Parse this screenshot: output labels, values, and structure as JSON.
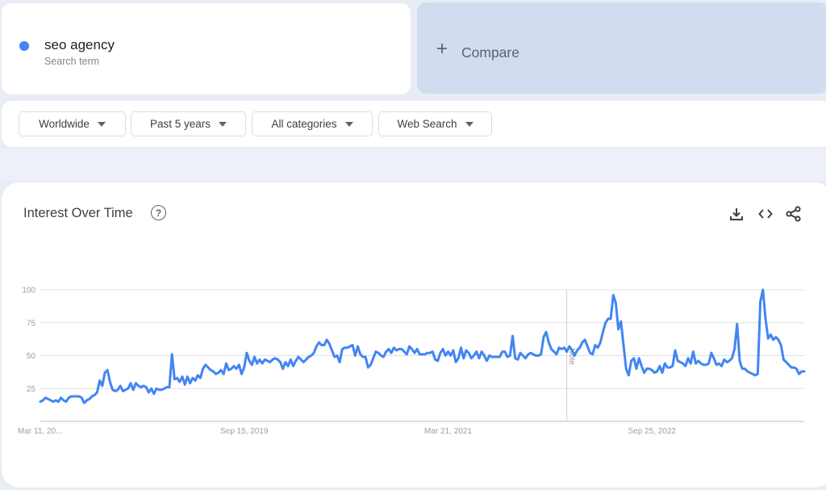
{
  "search_term": {
    "name": "seo agency",
    "subtitle": "Search term",
    "color": "#4285f4"
  },
  "compare": {
    "icon": "plus-icon",
    "label": "Compare"
  },
  "filters": [
    {
      "label": "Worldwide",
      "icon": "caret-down-icon"
    },
    {
      "label": "Past 5 years",
      "icon": "caret-down-icon"
    },
    {
      "label": "All categories",
      "icon": "caret-down-icon"
    },
    {
      "label": "Web Search",
      "icon": "caret-down-icon"
    }
  ],
  "panel": {
    "title": "Interest Over Time",
    "help_icon": "help-circle-icon",
    "help_glyph": "?",
    "tools": [
      "download-icon",
      "embed-code-icon",
      "share-icon"
    ]
  },
  "chart_data": {
    "type": "line",
    "title": "Interest Over Time",
    "xlabel": "",
    "ylabel": "",
    "ylim": [
      0,
      100
    ],
    "yticks": [
      "25",
      "50",
      "75",
      "100"
    ],
    "ytick_values": [
      25,
      50,
      75,
      100
    ],
    "xtick_labels": [
      "Mar 11, 20...",
      "Sep 15, 2019",
      "Mar 21, 2021",
      "Sep 25, 2022"
    ],
    "xtick_indices": [
      0,
      79,
      158,
      237
    ],
    "grid": true,
    "legend": "none",
    "annotation": {
      "label": "Note",
      "index": 204
    },
    "series": [
      {
        "name": "seo agency",
        "color": "#4285f4",
        "values": [
          15,
          16,
          18,
          17,
          16,
          15,
          16,
          15,
          18,
          16,
          15,
          18,
          19,
          19,
          19,
          19,
          18,
          14,
          16,
          17,
          19,
          20,
          22,
          31,
          27,
          37,
          39,
          30,
          24,
          23,
          24,
          27,
          23,
          24,
          25,
          29,
          24,
          29,
          27,
          26,
          27,
          26,
          22,
          25,
          21,
          25,
          24,
          24,
          25,
          26,
          26,
          51,
          32,
          33,
          30,
          34,
          28,
          34,
          29,
          33,
          31,
          35,
          33,
          40,
          43,
          41,
          39,
          38,
          36,
          37,
          39,
          36,
          44,
          39,
          40,
          42,
          40,
          43,
          36,
          41,
          52,
          46,
          43,
          49,
          44,
          47,
          44,
          47,
          46,
          45,
          47,
          48,
          47,
          45,
          40,
          45,
          42,
          47,
          42,
          46,
          49,
          47,
          45,
          47,
          49,
          50,
          52,
          57,
          60,
          58,
          58,
          62,
          59,
          54,
          49,
          50,
          45,
          55,
          56,
          56,
          57,
          58,
          50,
          57,
          51,
          49,
          49,
          41,
          43,
          48,
          53,
          52,
          50,
          49,
          53,
          55,
          52,
          56,
          54,
          55,
          55,
          53,
          51,
          57,
          55,
          52,
          55,
          51,
          51,
          51,
          52,
          52,
          53,
          47,
          46,
          52,
          55,
          50,
          53,
          50,
          54,
          45,
          48,
          56,
          48,
          54,
          52,
          48,
          50,
          53,
          48,
          53,
          50,
          46,
          50,
          49,
          49,
          49,
          49,
          53,
          53,
          49,
          50,
          65,
          48,
          47,
          52,
          50,
          48,
          51,
          52,
          51,
          50,
          50,
          51,
          64,
          68,
          60,
          55,
          53,
          51,
          56,
          55,
          56,
          53,
          57,
          54,
          50,
          54,
          56,
          60,
          62,
          57,
          52,
          51,
          58,
          56,
          60,
          68,
          75,
          78,
          78,
          96,
          90,
          70,
          76,
          58,
          40,
          35,
          46,
          48,
          40,
          48,
          42,
          37,
          40,
          40,
          39,
          37,
          38,
          42,
          37,
          44,
          41,
          41,
          42,
          54,
          46,
          45,
          44,
          42,
          48,
          44,
          53,
          44,
          46,
          44,
          43,
          43,
          44,
          52,
          48,
          43,
          44,
          42,
          47,
          45,
          46,
          48,
          55,
          74,
          46,
          40,
          40,
          38,
          37,
          36,
          35,
          36,
          91,
          100,
          78,
          63,
          66,
          62,
          64,
          62,
          58,
          47,
          45,
          43,
          41,
          41,
          40,
          36,
          38,
          38
        ]
      }
    ]
  }
}
